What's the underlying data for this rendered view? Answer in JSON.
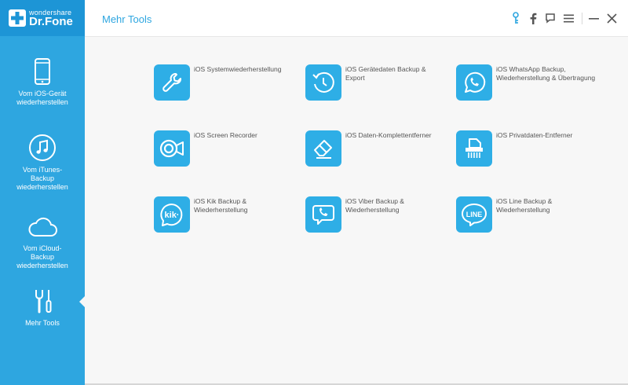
{
  "app": {
    "brand_small": "wondershare",
    "brand_big": "Dr.Fone",
    "page_title": "Mehr Tools"
  },
  "colors": {
    "accent": "#2ea6e0",
    "sidebar": "#2ea6e0",
    "tile": "#2eaee6"
  },
  "header": {
    "icons": [
      "key-icon",
      "facebook-icon",
      "feedback-icon",
      "menu-icon",
      "minimize-icon",
      "close-icon"
    ]
  },
  "sidebar": {
    "items": [
      {
        "label": "Vom iOS-Gerät wiederherstellen",
        "icon": "phone-icon"
      },
      {
        "label": "Vom iTunes-Backup wiederherstellen",
        "icon": "music-icon"
      },
      {
        "label": "Vom iCloud-Backup wiederherstellen",
        "icon": "cloud-icon"
      },
      {
        "label": "Mehr Tools",
        "icon": "tools-icon",
        "active": true
      }
    ]
  },
  "tools": [
    {
      "label": "iOS Systemwiederherstellung",
      "icon": "wrench-icon"
    },
    {
      "label": "iOS Gerätedaten Backup & Export",
      "icon": "clock-icon"
    },
    {
      "label": "iOS WhatsApp Backup, Wiederherstellung & Übertragung",
      "icon": "whatsapp-icon"
    },
    {
      "label": "iOS Screen Recorder",
      "icon": "screen-recorder-icon"
    },
    {
      "label": "iOS Daten-Komplettentferner",
      "icon": "eraser-icon"
    },
    {
      "label": "iOS Privatdaten-Entferner",
      "icon": "shredder-icon"
    },
    {
      "label": "iOS Kik Backup & Wiederherstellung",
      "icon": "kik-icon"
    },
    {
      "label": "iOS Viber Backup & Wiederherstellung",
      "icon": "viber-icon"
    },
    {
      "label": "iOS Line Backup & Wiederherstellung",
      "icon": "line-icon"
    }
  ]
}
